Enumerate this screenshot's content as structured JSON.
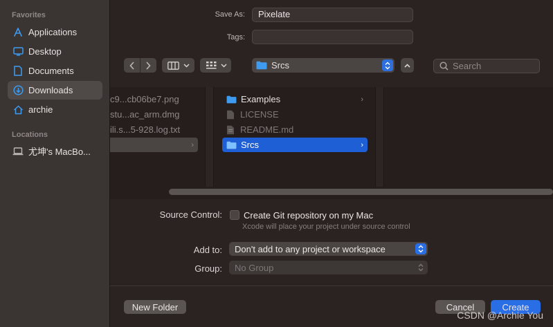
{
  "sidebar": {
    "favorites_header": "Favorites",
    "favorites": [
      {
        "label": "Applications",
        "icon": "applications-icon"
      },
      {
        "label": "Desktop",
        "icon": "desktop-icon"
      },
      {
        "label": "Documents",
        "icon": "document-icon"
      },
      {
        "label": "Downloads",
        "icon": "downloads-icon",
        "selected": true
      },
      {
        "label": "archie",
        "icon": "home-icon"
      }
    ],
    "locations_header": "Locations",
    "locations": [
      {
        "label": "尤坤's MacBo...",
        "icon": "laptop-icon"
      }
    ]
  },
  "save": {
    "save_as_label": "Save As:",
    "save_as_value": "Pixelate",
    "tags_label": "Tags:",
    "tags_value": ""
  },
  "toolbar": {
    "location": "Srcs",
    "search_placeholder": "Search"
  },
  "browser": {
    "column1": [
      "c9...cb06be7.png",
      "stu...ac_arm.dmg",
      "ili.s...5-928.log.txt"
    ],
    "column2": [
      {
        "label": "Examples",
        "type": "folder",
        "has_children": true
      },
      {
        "label": "LICENSE",
        "type": "file",
        "dimmed": true
      },
      {
        "label": "README.md",
        "type": "file",
        "dimmed": true
      },
      {
        "label": "Srcs",
        "type": "folder",
        "has_children": true,
        "selected": true
      }
    ]
  },
  "options": {
    "source_control_label": "Source Control:",
    "git_checkbox_label": "Create Git repository on my Mac",
    "git_hint": "Xcode will place your project under source control",
    "add_to_label": "Add to:",
    "add_to_value": "Don't add to any project or workspace",
    "group_label": "Group:",
    "group_value": "No Group"
  },
  "buttons": {
    "new_folder": "New Folder",
    "cancel": "Cancel",
    "create": "Create"
  },
  "watermark": "CSDN @Archie You",
  "colors": {
    "accent": "#2a6ee6",
    "folder": "#3f9bf0",
    "selection": "#1f5fd6"
  }
}
